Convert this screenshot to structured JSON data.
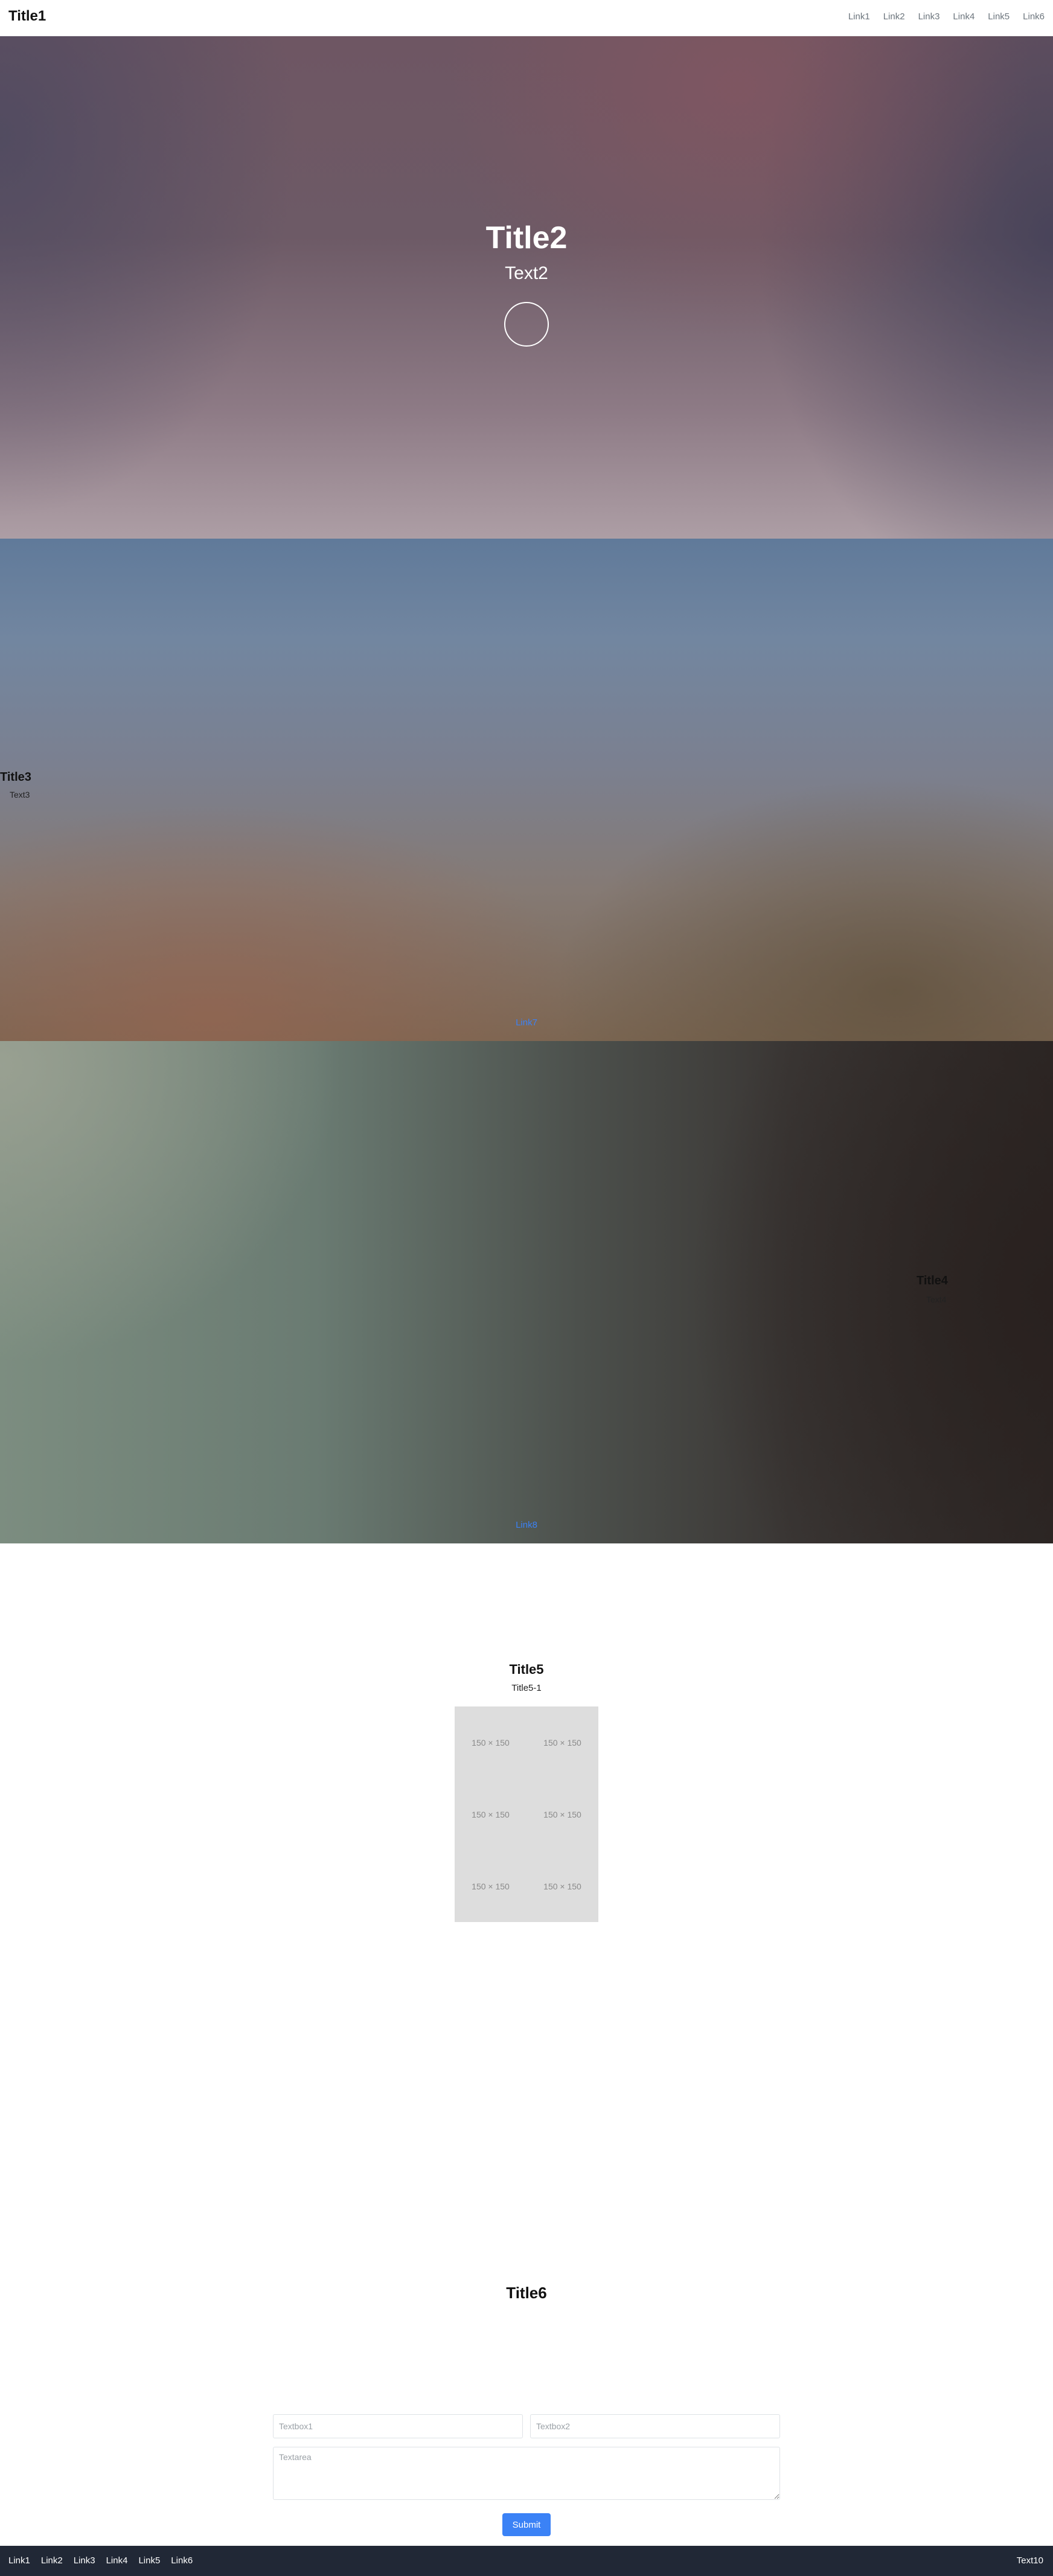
{
  "header": {
    "title": "Title1",
    "nav": [
      "Link1",
      "Link2",
      "Link3",
      "Link4",
      "Link5",
      "Link6"
    ]
  },
  "hero1": {
    "title": "Title2",
    "text": "Text2"
  },
  "section2": {
    "title": "Title3",
    "text": "Text3",
    "link": "Link7"
  },
  "section3": {
    "title": "Title4",
    "text": "Text4",
    "link": "Link8"
  },
  "gallery": {
    "title": "Title5",
    "subtitle": "Title5-1",
    "images": [
      "150 × 150",
      "150 × 150",
      "150 × 150",
      "150 × 150",
      "150 × 150",
      "150 × 150"
    ]
  },
  "contact": {
    "title": "Title6",
    "textbox1_placeholder": "Textbox1",
    "textbox2_placeholder": "Textbox2",
    "textarea_placeholder": "Textarea",
    "submit_label": "Submit"
  },
  "footer": {
    "links": [
      "Link1",
      "Link2",
      "Link3",
      "Link4",
      "Link5",
      "Link6"
    ],
    "text": "Text10"
  },
  "colors": {
    "accent": "#3b82f6",
    "footer_bg": "#212836",
    "placeholder_bg": "#dddddd"
  }
}
